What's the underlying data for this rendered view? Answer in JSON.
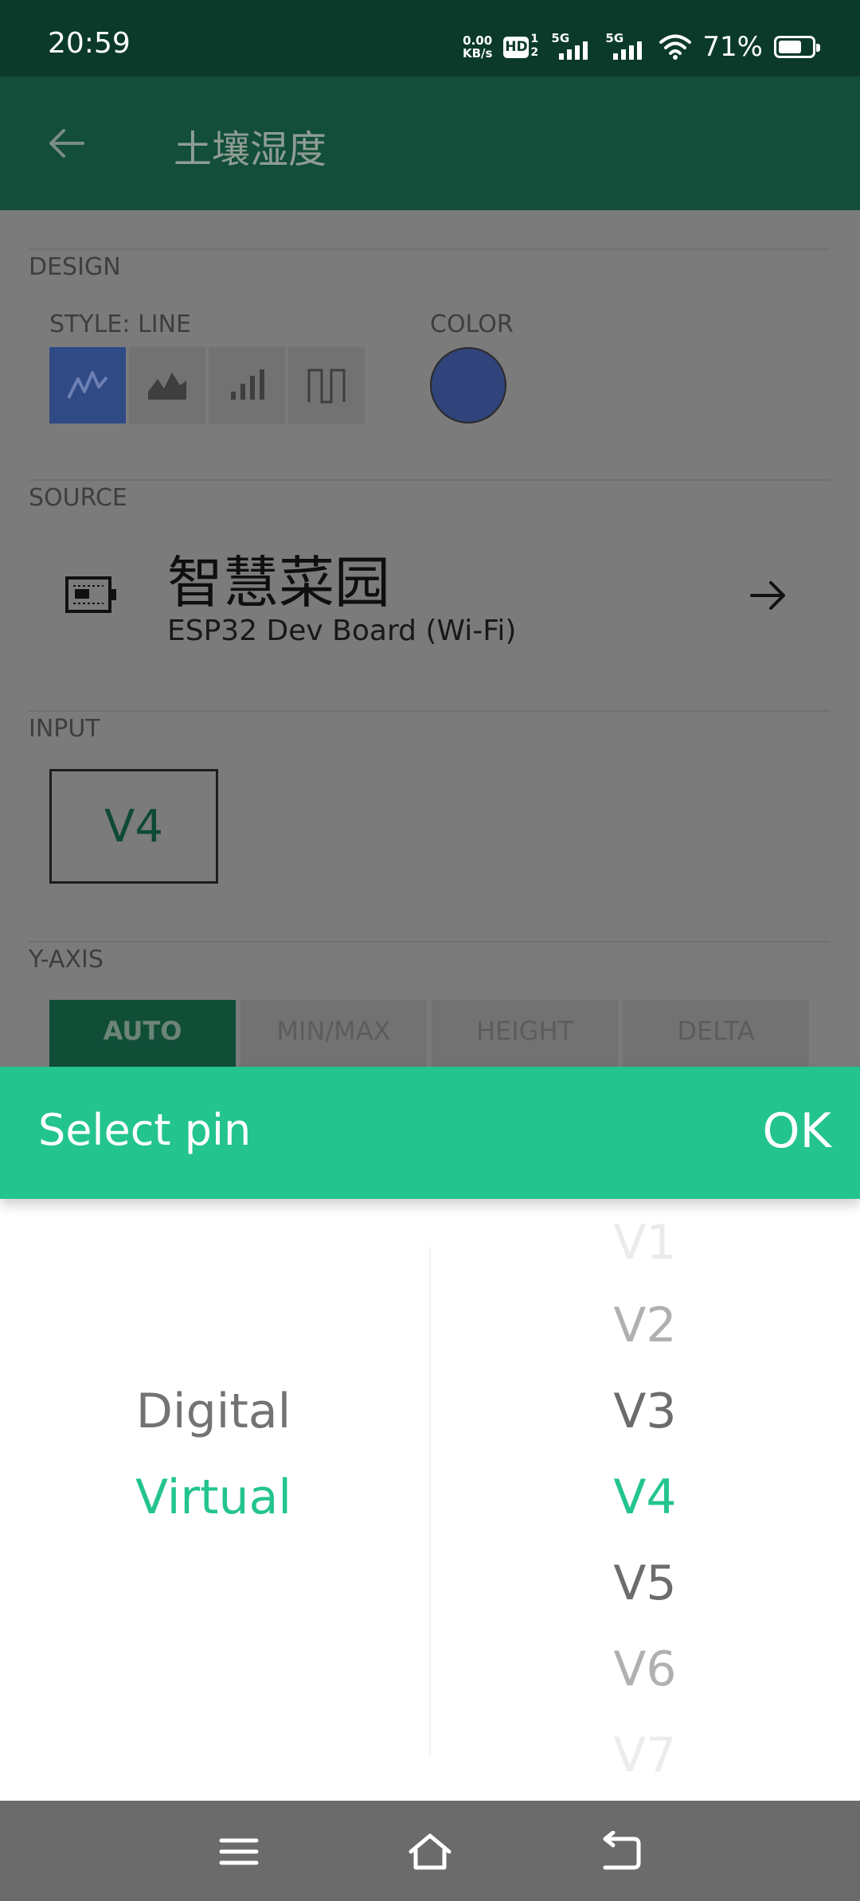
{
  "status_bar": {
    "time": "20:59",
    "net_speed_value": "0.00",
    "net_speed_unit": "KB/s",
    "hd_label": "HD",
    "hd_sup": "1",
    "hd_sub": "2",
    "sim1_label": "5G",
    "sim2_label": "5G",
    "battery_percent": "71%",
    "battery_level": 0.71
  },
  "app_bar": {
    "title": "土壤湿度",
    "back_icon": "arrow-left-icon"
  },
  "design": {
    "section_label": "DESIGN",
    "style_label": "STYLE: LINE",
    "color_label": "COLOR",
    "styles": [
      {
        "name": "line-chart-icon",
        "active": true
      },
      {
        "name": "area-chart-icon",
        "active": false
      },
      {
        "name": "bar-chart-icon",
        "active": false
      },
      {
        "name": "step-chart-icon",
        "active": false
      }
    ],
    "color": "#3A4FA0"
  },
  "source": {
    "section_label": "SOURCE",
    "device_name": "智慧菜园",
    "device_board": "ESP32 Dev Board (Wi-Fi)"
  },
  "input": {
    "section_label": "INPUT",
    "pin": "V4"
  },
  "y_axis": {
    "section_label": "Y-AXIS",
    "options": [
      "AUTO",
      "MIN/MAX",
      "HEIGHT",
      "DELTA"
    ],
    "selected": "AUTO"
  },
  "picker": {
    "title": "Select pin",
    "ok_label": "OK",
    "types": [
      "Digital",
      "Virtual"
    ],
    "selected_type": "Virtual",
    "pins": [
      "V1",
      "V2",
      "V3",
      "V4",
      "V5",
      "V6",
      "V7"
    ],
    "selected_pin": "V4"
  },
  "colors": {
    "accent": "#23C48E",
    "selected_text": "#23C48E"
  }
}
